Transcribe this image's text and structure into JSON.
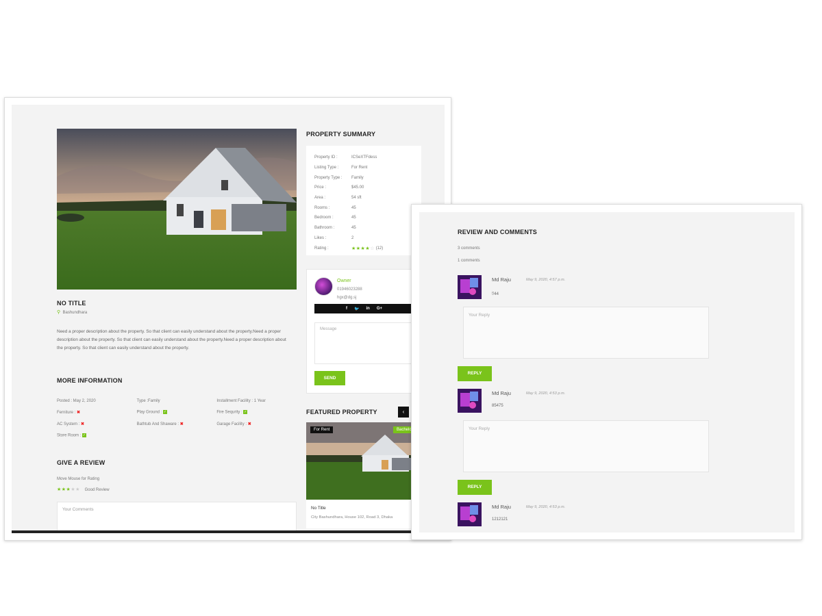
{
  "property": {
    "title": "NO TITLE",
    "location": "Bashundhara",
    "description": "Need a proper description about the property. So that client can easily understand about the property.Need a proper description about the property. So that client can easily understand about the property.Need a proper description about the property. So that client can easily understand about the property."
  },
  "more_info": {
    "heading": "MORE INFORMATION",
    "rows": [
      [
        "Posted : May 2, 2020",
        "Type :Family",
        "Installment Facility : 1 Year"
      ],
      [
        "Ferniture :",
        "Play Ground :",
        "Fire Sequrity :"
      ],
      [
        "AC System :",
        "Bathtub And Shaware :",
        "Garage Facility :"
      ],
      [
        "Store Room :",
        "",
        ""
      ]
    ]
  },
  "review_form": {
    "heading": "GIVE A REVIEW",
    "hint": "Move Mouse for Rating",
    "rating_label": "Good Review",
    "rating": 3,
    "comments_placeholder": "Your Comments"
  },
  "summary": {
    "heading": "PROPERTY SUMMARY",
    "rows": [
      {
        "k": "Property ID :",
        "v": "ICSeXTFdess"
      },
      {
        "k": "Listing Type :",
        "v": "For Rent"
      },
      {
        "k": "Property Type :",
        "v": "Family"
      },
      {
        "k": "Price :",
        "v": "$45.00"
      },
      {
        "k": "Area :",
        "v": "54 sft"
      },
      {
        "k": "Rooms :",
        "v": "45"
      },
      {
        "k": "Bedroom :",
        "v": "45"
      },
      {
        "k": "Bathroom :",
        "v": "45"
      },
      {
        "k": "Likes :",
        "v": "2"
      },
      {
        "k": "Rating :",
        "v": ""
      }
    ],
    "rating": 4,
    "rating_count": "(12)"
  },
  "agent": {
    "name": "Owner",
    "phone": "01946023288",
    "email": "hgx@dg.sj",
    "social": [
      "f",
      "t",
      "in",
      "G+"
    ],
    "message_placeholder": "Message",
    "send_label": "SEND"
  },
  "featured": {
    "heading": "FEATURED PROPERTY",
    "tag_rent": "For Rent",
    "tag_type": "Bachelor",
    "title": "No Title",
    "address": "City Bashundhara, House 102, Road 3, Dhaka"
  },
  "comments_panel": {
    "heading": "REVIEW AND COMMENTS",
    "count1": "3 comments",
    "count2": "1 comments",
    "reply_placeholder": "Your Reply",
    "reply_label": "REPLY",
    "items": [
      {
        "author": "Md Raju",
        "date": "May 9, 2020, 4:57 p.m.",
        "text": "ট44"
      },
      {
        "author": "Md Raju",
        "date": "May 9, 2020, 4:53 p.m.",
        "text": "85475"
      },
      {
        "author": "Md Raju",
        "date": "May 9, 2020, 4:53 p.m.",
        "text": "1212121"
      }
    ]
  },
  "colors": {
    "accent": "#7ac31b",
    "dark": "#111111",
    "panel_bg": "#f3f3f3"
  }
}
